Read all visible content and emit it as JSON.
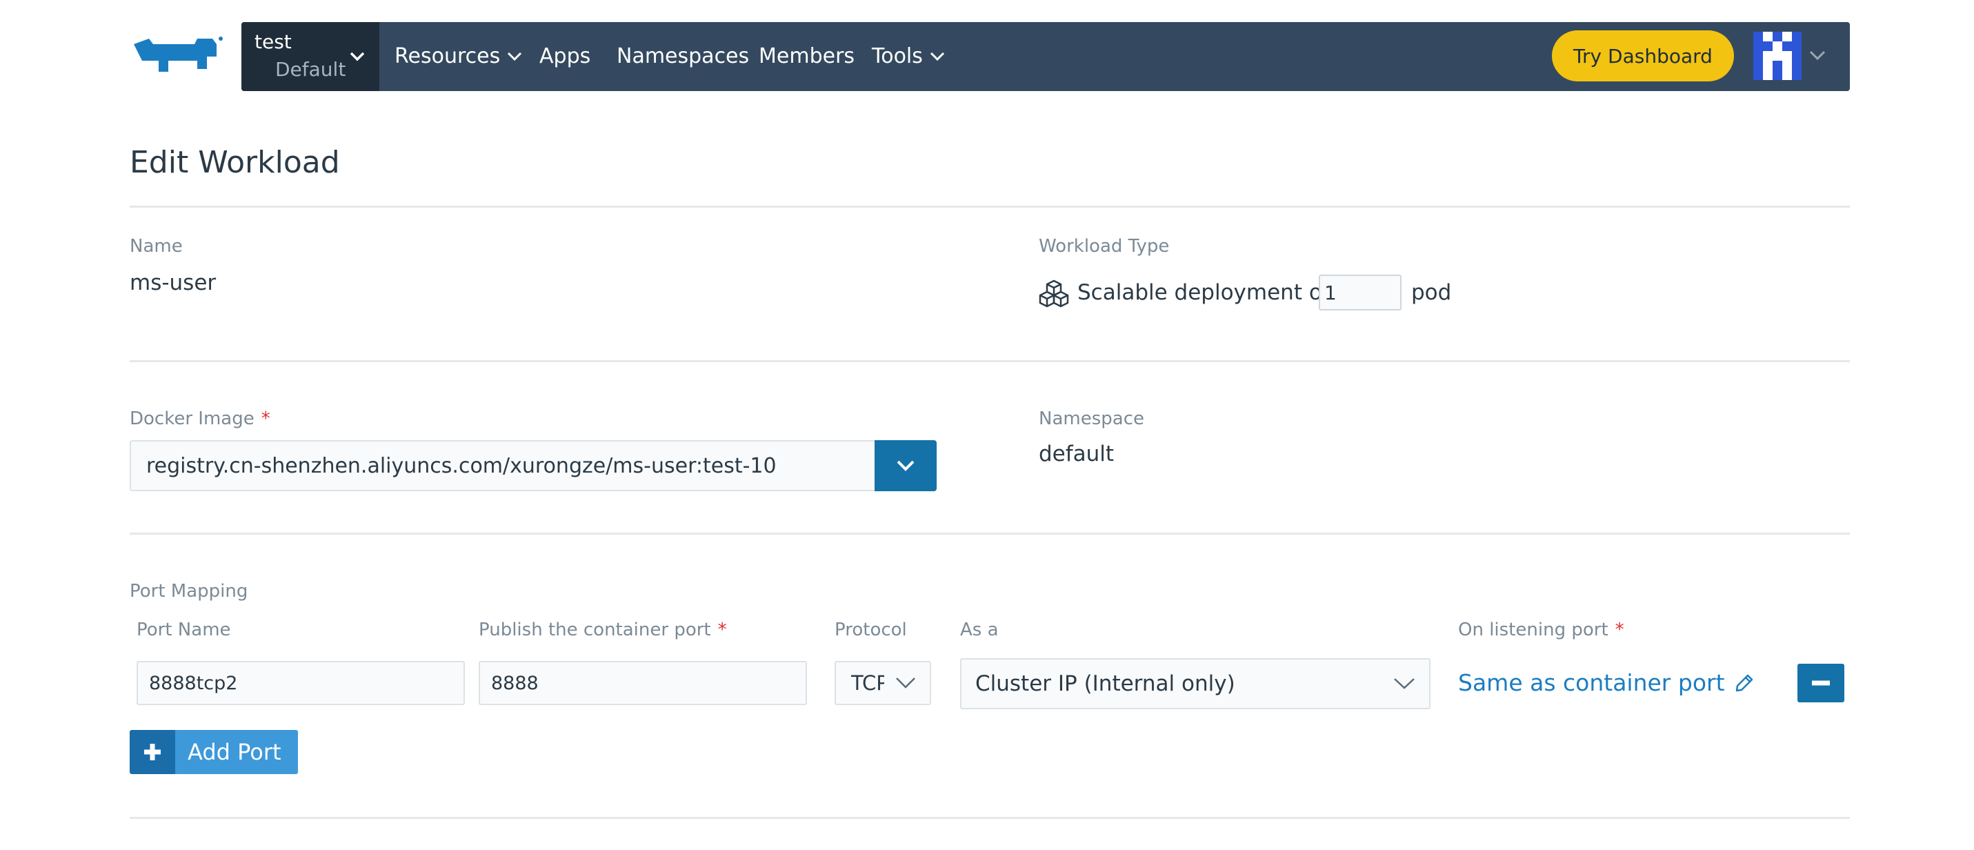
{
  "header": {
    "context": {
      "cluster": "test",
      "project": "Default"
    },
    "nav": [
      "Resources",
      "Apps",
      "Namespaces",
      "Members",
      "Tools"
    ],
    "try_dashboard": "Try Dashboard"
  },
  "page": {
    "title": "Edit Workload",
    "name_label": "Name",
    "name_value": "ms-user",
    "workload_type_label": "Workload Type",
    "workload_prefix": "Scalable deployment of",
    "replicas": "1",
    "workload_suffix": "pod",
    "image_label": "Docker Image",
    "required_mark": "*",
    "image_value": "registry.cn-shenzhen.aliyuncs.com/xurongze/ms-user:test-10",
    "namespace_label": "Namespace",
    "namespace_value": "default"
  },
  "ports": {
    "section_label": "Port Mapping",
    "headers": {
      "port_name": "Port Name",
      "container_port": "Publish the container port",
      "protocol": "Protocol",
      "as_a": "As a",
      "listening_port": "On listening port"
    },
    "row": {
      "port_name": "8888tcp2",
      "container_port": "8888",
      "protocol": "TCP",
      "as_a": "Cluster IP (Internal only)",
      "listening_port": "Same as container port"
    },
    "add_label": "Add Port"
  },
  "icons": {
    "logo": "rancher-cow-logo",
    "workload": "cube-icon",
    "edit": "pencil-icon",
    "remove": "minus-icon",
    "add": "plus-icon"
  },
  "colors": {
    "navbar": "#34495f",
    "context": "#1f2d3a",
    "try_button": "#f2c311",
    "primary": "#1472a8",
    "link": "#1b7dc1",
    "required": "#e0322e"
  }
}
